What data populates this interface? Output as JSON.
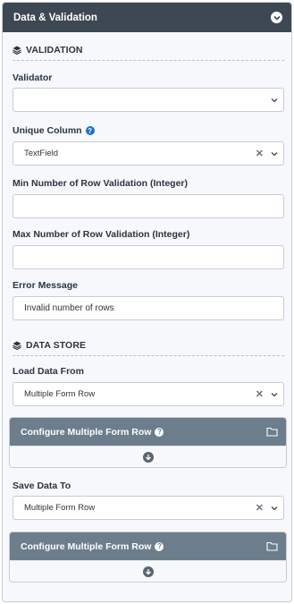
{
  "panel": {
    "title": "Data & Validation"
  },
  "validation": {
    "heading": "VALIDATION",
    "validator_label": "Validator",
    "validator_value": "",
    "unique_column_label": "Unique Column",
    "unique_column_value": "TextField",
    "min_rows_label": "Min Number of Row Validation (Integer)",
    "min_rows_value": "",
    "max_rows_label": "Max Number of Row Validation (Integer)",
    "max_rows_value": "",
    "error_message_label": "Error Message",
    "error_message_value": "Invalid number of rows"
  },
  "data_store": {
    "heading": "DATA STORE",
    "load_label": "Load Data From",
    "load_value": "Multiple Form Row",
    "configure_load_title": "Configure Multiple Form Row",
    "save_label": "Save Data To",
    "save_value": "Multiple Form Row",
    "configure_save_title": "Configure Multiple Form Row"
  },
  "colors": {
    "header_bg": "#3d4852",
    "card_header_bg": "#6c7d8c",
    "help_icon": "#1f6fd1"
  }
}
